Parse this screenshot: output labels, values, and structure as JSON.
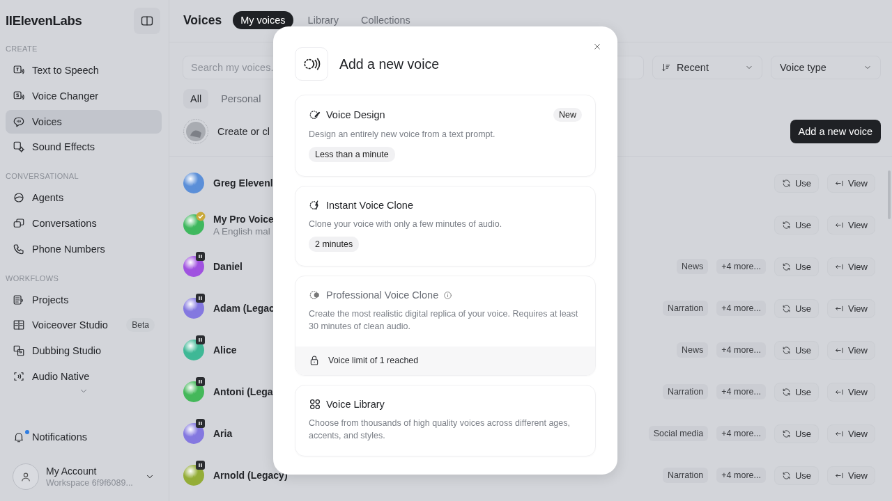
{
  "sidebar": {
    "logo": "IIElevenLabs",
    "sections": [
      {
        "label": "CREATE",
        "items": [
          {
            "label": "Text to Speech",
            "kind": "tts",
            "selected": false
          },
          {
            "label": "Voice Changer",
            "kind": "changer",
            "selected": false
          },
          {
            "label": "Voices",
            "kind": "voices",
            "selected": true
          },
          {
            "label": "Sound Effects",
            "kind": "sfx",
            "selected": false
          }
        ]
      },
      {
        "label": "CONVERSATIONAL",
        "items": [
          {
            "label": "Agents",
            "kind": "agents",
            "selected": false
          },
          {
            "label": "Conversations",
            "kind": "conversations",
            "selected": false
          },
          {
            "label": "Phone Numbers",
            "kind": "phone",
            "selected": false
          }
        ]
      },
      {
        "label": "WORKFLOWS",
        "items": [
          {
            "label": "Projects",
            "kind": "projects",
            "selected": false
          },
          {
            "label": "Voiceover Studio",
            "kind": "voiceover",
            "selected": false,
            "badge": "Beta"
          },
          {
            "label": "Dubbing Studio",
            "kind": "dubbing",
            "selected": false
          },
          {
            "label": "Audio Native",
            "kind": "native",
            "selected": false
          }
        ]
      }
    ],
    "notifications": {
      "label": "Notifications",
      "unread": true
    },
    "account": {
      "name": "My Account",
      "workspace": "Workspace 6f9f6089..."
    }
  },
  "main": {
    "title": "Voices",
    "tabs": [
      {
        "label": "My voices",
        "selected": true
      },
      {
        "label": "Library",
        "selected": false
      },
      {
        "label": "Collections",
        "selected": false
      }
    ],
    "search": {
      "placeholder": "Search my voices."
    },
    "sort": {
      "value": "Recent"
    },
    "type_filter": {
      "value": "Voice type"
    },
    "filters": [
      {
        "label": "All",
        "selected": true
      },
      {
        "label": "Personal",
        "selected": false
      }
    ],
    "create_row": {
      "text": "Create or cl"
    },
    "add_button": "Add a new voice",
    "voices": [
      {
        "name": "Greg Elevenl",
        "color": "#5b8fd8",
        "kind": "plain",
        "use": "Use",
        "view": "View"
      },
      {
        "name": "My Pro Voice",
        "subtitle": "A English mal",
        "color": "#3fb85e",
        "kind": "verified",
        "use": "Use",
        "view": "View"
      },
      {
        "name": "Daniel",
        "color": "#a052e0",
        "kind": "premade",
        "tags": [
          "News"
        ],
        "more": "+4 more...",
        "use": "Use",
        "view": "View"
      },
      {
        "name": "Adam (Legac",
        "color": "#8478e0",
        "kind": "premade",
        "tags": [
          "Narration"
        ],
        "more": "+4 more...",
        "use": "Use",
        "view": "View"
      },
      {
        "name": "Alice",
        "color": "#3fb896",
        "kind": "premade",
        "tags": [
          "News"
        ],
        "more": "+4 more...",
        "use": "Use",
        "view": "View"
      },
      {
        "name": "Antoni (Lega",
        "color": "#44b85a",
        "kind": "premade",
        "tags": [
          "Narration"
        ],
        "more": "+4 more...",
        "use": "Use",
        "view": "View"
      },
      {
        "name": "Aria",
        "color": "#8478e0",
        "kind": "premade",
        "tags": [
          "Social media"
        ],
        "more": "+4 more...",
        "use": "Use",
        "view": "View"
      },
      {
        "name": "Arnold (Legacy)",
        "color": "#94ad38",
        "kind": "premade",
        "tags": [
          "Narration"
        ],
        "more": "+4 more...",
        "use": "Use",
        "view": "View"
      }
    ]
  },
  "modal": {
    "title": "Add a new voice",
    "options": [
      {
        "kind": "design",
        "title": "Voice Design",
        "badge": "New",
        "description": "Design an entirely new voice from a text prompt.",
        "duration": "Less than a minute",
        "disabled": false
      },
      {
        "kind": "instant",
        "title": "Instant Voice Clone",
        "description": "Clone your voice with only a few minutes of audio.",
        "duration": "2 minutes",
        "disabled": false
      },
      {
        "kind": "professional",
        "title": "Professional Voice Clone",
        "description": "Create the most realistic digital replica of your voice. Requires at least 30 minutes of clean audio.",
        "disabled": true,
        "notice": "Voice limit of 1 reached"
      },
      {
        "kind": "library",
        "title": "Voice Library",
        "description": "Choose from thousands of high quality voices across different ages, accents, and styles.",
        "disabled": false
      }
    ]
  }
}
